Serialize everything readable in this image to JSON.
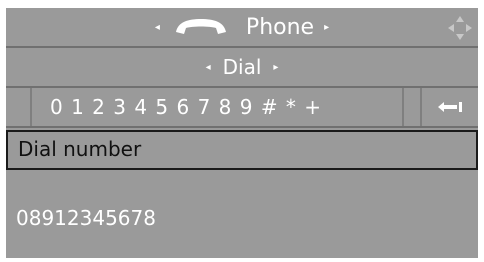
{
  "header": {
    "title": "Phone",
    "left_arrow": "◂",
    "right_arrow": "▸",
    "handset_icon": "phone-handset-icon",
    "corner_icon": "joystick-direction-icon"
  },
  "subheader": {
    "title": "Dial",
    "left_arrow": "◂",
    "right_arrow": "▸"
  },
  "keypad": {
    "characters": "0 1 2 3 4 5 6 7 8 9 # * +",
    "backspace_icon": "backspace-arrow-icon"
  },
  "input": {
    "label": "Dial number",
    "value": "08912345678"
  },
  "colors": {
    "background": "#9a9a9a",
    "text_light": "#ffffff",
    "text_dark": "#111111",
    "border": "#1a1a1a"
  }
}
